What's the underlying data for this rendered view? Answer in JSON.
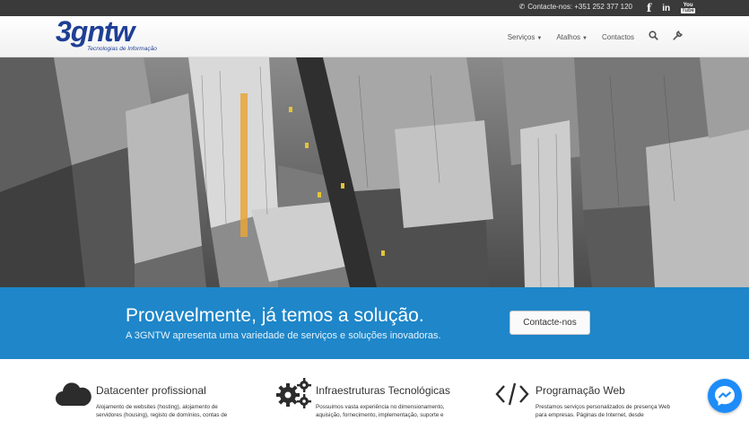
{
  "topbar": {
    "contact_label": "Contacte-nos: +351 252 377 120",
    "social": {
      "facebook": "f",
      "linkedin": "in",
      "youtube_top": "You",
      "youtube_bottom": "Tube"
    }
  },
  "header": {
    "logo_text": "3gntw",
    "logo_sub": "Tecnologias de Informação",
    "nav": [
      {
        "label": "Serviços",
        "has_caret": true
      },
      {
        "label": "Atalhos",
        "has_caret": true
      },
      {
        "label": "Contactos",
        "has_caret": false
      }
    ],
    "icons": [
      "search-icon",
      "wrench-icon"
    ]
  },
  "band": {
    "title": "Provavelmente, já temos a solução.",
    "subtitle": "A 3GNTW apresenta uma variedade de serviços e soluções inovadoras.",
    "button": "Contacte-nos"
  },
  "services": [
    {
      "title": "Datacenter profissional",
      "lines": [
        "Alojamento de websites (hosting), alojamento de",
        "servidores (housing), registo de domínios, contas de"
      ],
      "icon": "cloud-icon"
    },
    {
      "title": "Infraestruturas Tecnológicas",
      "lines": [
        "Possuimos vasta experiência no dimensionamento,",
        "aquisição, fornecimento, implementação, suporte e"
      ],
      "icon": "gears-icon"
    },
    {
      "title": "Programação Web",
      "lines": [
        "Prestamos serviços personalizados de presença Web",
        "para empresas. Páginas de Internet, desde"
      ],
      "icon": "code-icon"
    }
  ],
  "colors": {
    "topbar": "#3a3a3a",
    "logo": "#1f3f95",
    "band": "#1e86c9",
    "messenger": "#1d8cf8"
  }
}
